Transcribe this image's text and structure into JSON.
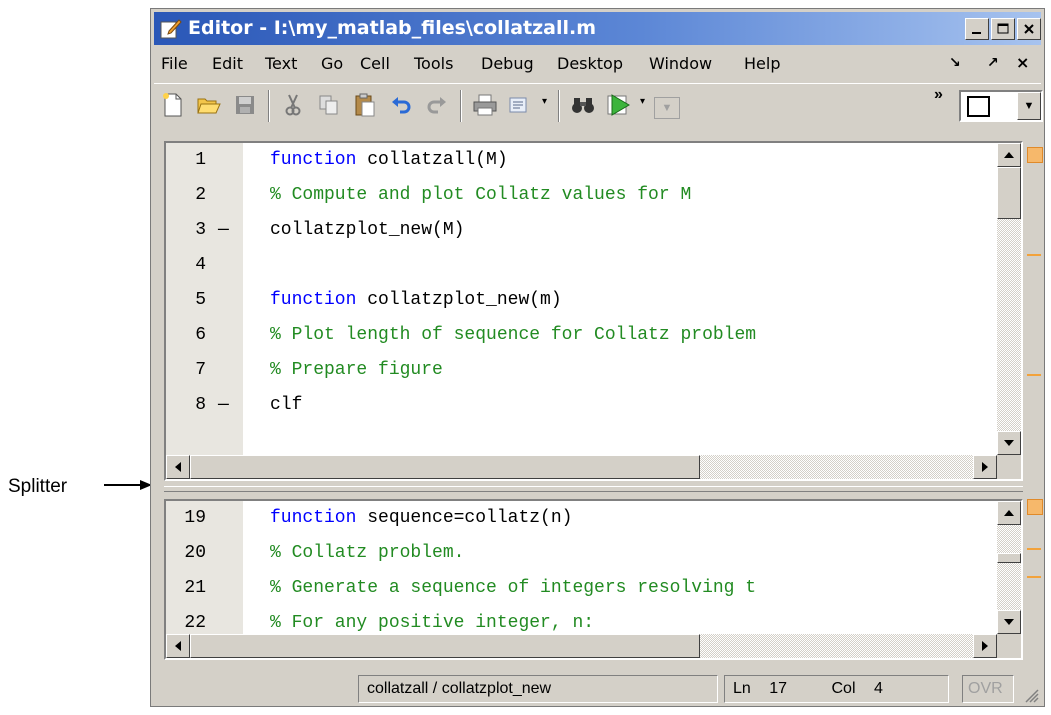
{
  "annotation": {
    "label": "Splitter"
  },
  "window": {
    "title": "Editor - I:\\my_matlab_files\\collatzall.m",
    "buttons": {
      "minimize": "_",
      "maximize": "□",
      "close": "×"
    }
  },
  "menu": {
    "items": [
      "File",
      "Edit",
      "Text",
      "Go",
      "Cell",
      "Tools",
      "Debug",
      "Desktop",
      "Window",
      "Help"
    ],
    "right": {
      "dock": "↘",
      "undock": "↗",
      "close": "×"
    }
  },
  "toolbar": {
    "icons": [
      "new-file-icon",
      "open-folder-icon",
      "save-icon",
      "cut-icon",
      "copy-icon",
      "paste-icon",
      "undo-icon",
      "redo-icon",
      "print-icon",
      "find-files-icon",
      "binoculars-icon",
      "run-icon",
      "stack-dropdown"
    ],
    "overflow": "»"
  },
  "editor_top": {
    "lines": [
      {
        "num": "1",
        "dash": "",
        "segments": [
          {
            "cls": "kw",
            "text": "function "
          },
          {
            "cls": "txt",
            "text": "collatzall(M)"
          }
        ]
      },
      {
        "num": "2",
        "dash": "",
        "segments": [
          {
            "cls": "cm",
            "text": "% Compute and plot Collatz values for M"
          }
        ]
      },
      {
        "num": "3",
        "dash": "—",
        "segments": [
          {
            "cls": "txt",
            "text": "collatzplot_new(M)"
          }
        ]
      },
      {
        "num": "4",
        "dash": "",
        "segments": []
      },
      {
        "num": "5",
        "dash": "",
        "segments": [
          {
            "cls": "kw",
            "text": "function "
          },
          {
            "cls": "txt",
            "text": "collatzplot_new(m)"
          }
        ]
      },
      {
        "num": "6",
        "dash": "",
        "segments": [
          {
            "cls": "cm",
            "text": "% Plot length of sequence for Collatz problem"
          }
        ]
      },
      {
        "num": "7",
        "dash": "",
        "segments": [
          {
            "cls": "cm",
            "text": "% Prepare figure"
          }
        ]
      },
      {
        "num": "8",
        "dash": "—",
        "segments": [
          {
            "cls": "txt",
            "text": "clf"
          }
        ]
      }
    ]
  },
  "editor_bottom": {
    "lines": [
      {
        "num": "19",
        "dash": "",
        "segments": [
          {
            "cls": "kw",
            "text": "function "
          },
          {
            "cls": "txt",
            "text": "sequence=collatz(n)"
          }
        ]
      },
      {
        "num": "20",
        "dash": "",
        "segments": [
          {
            "cls": "cm",
            "text": "% Collatz problem."
          }
        ]
      },
      {
        "num": "21",
        "dash": "",
        "segments": [
          {
            "cls": "cm",
            "text": "% Generate a sequence of integers resolving t"
          }
        ]
      },
      {
        "num": "22",
        "dash": "",
        "segments": [
          {
            "cls": "cm",
            "text": "% For any positive integer, n:"
          }
        ]
      }
    ]
  },
  "status": {
    "function_path": "collatzall / collatzplot_new",
    "ln_label": "Ln",
    "ln_value": "17",
    "col_label": "Col",
    "col_value": "4",
    "mode": "OVR"
  }
}
